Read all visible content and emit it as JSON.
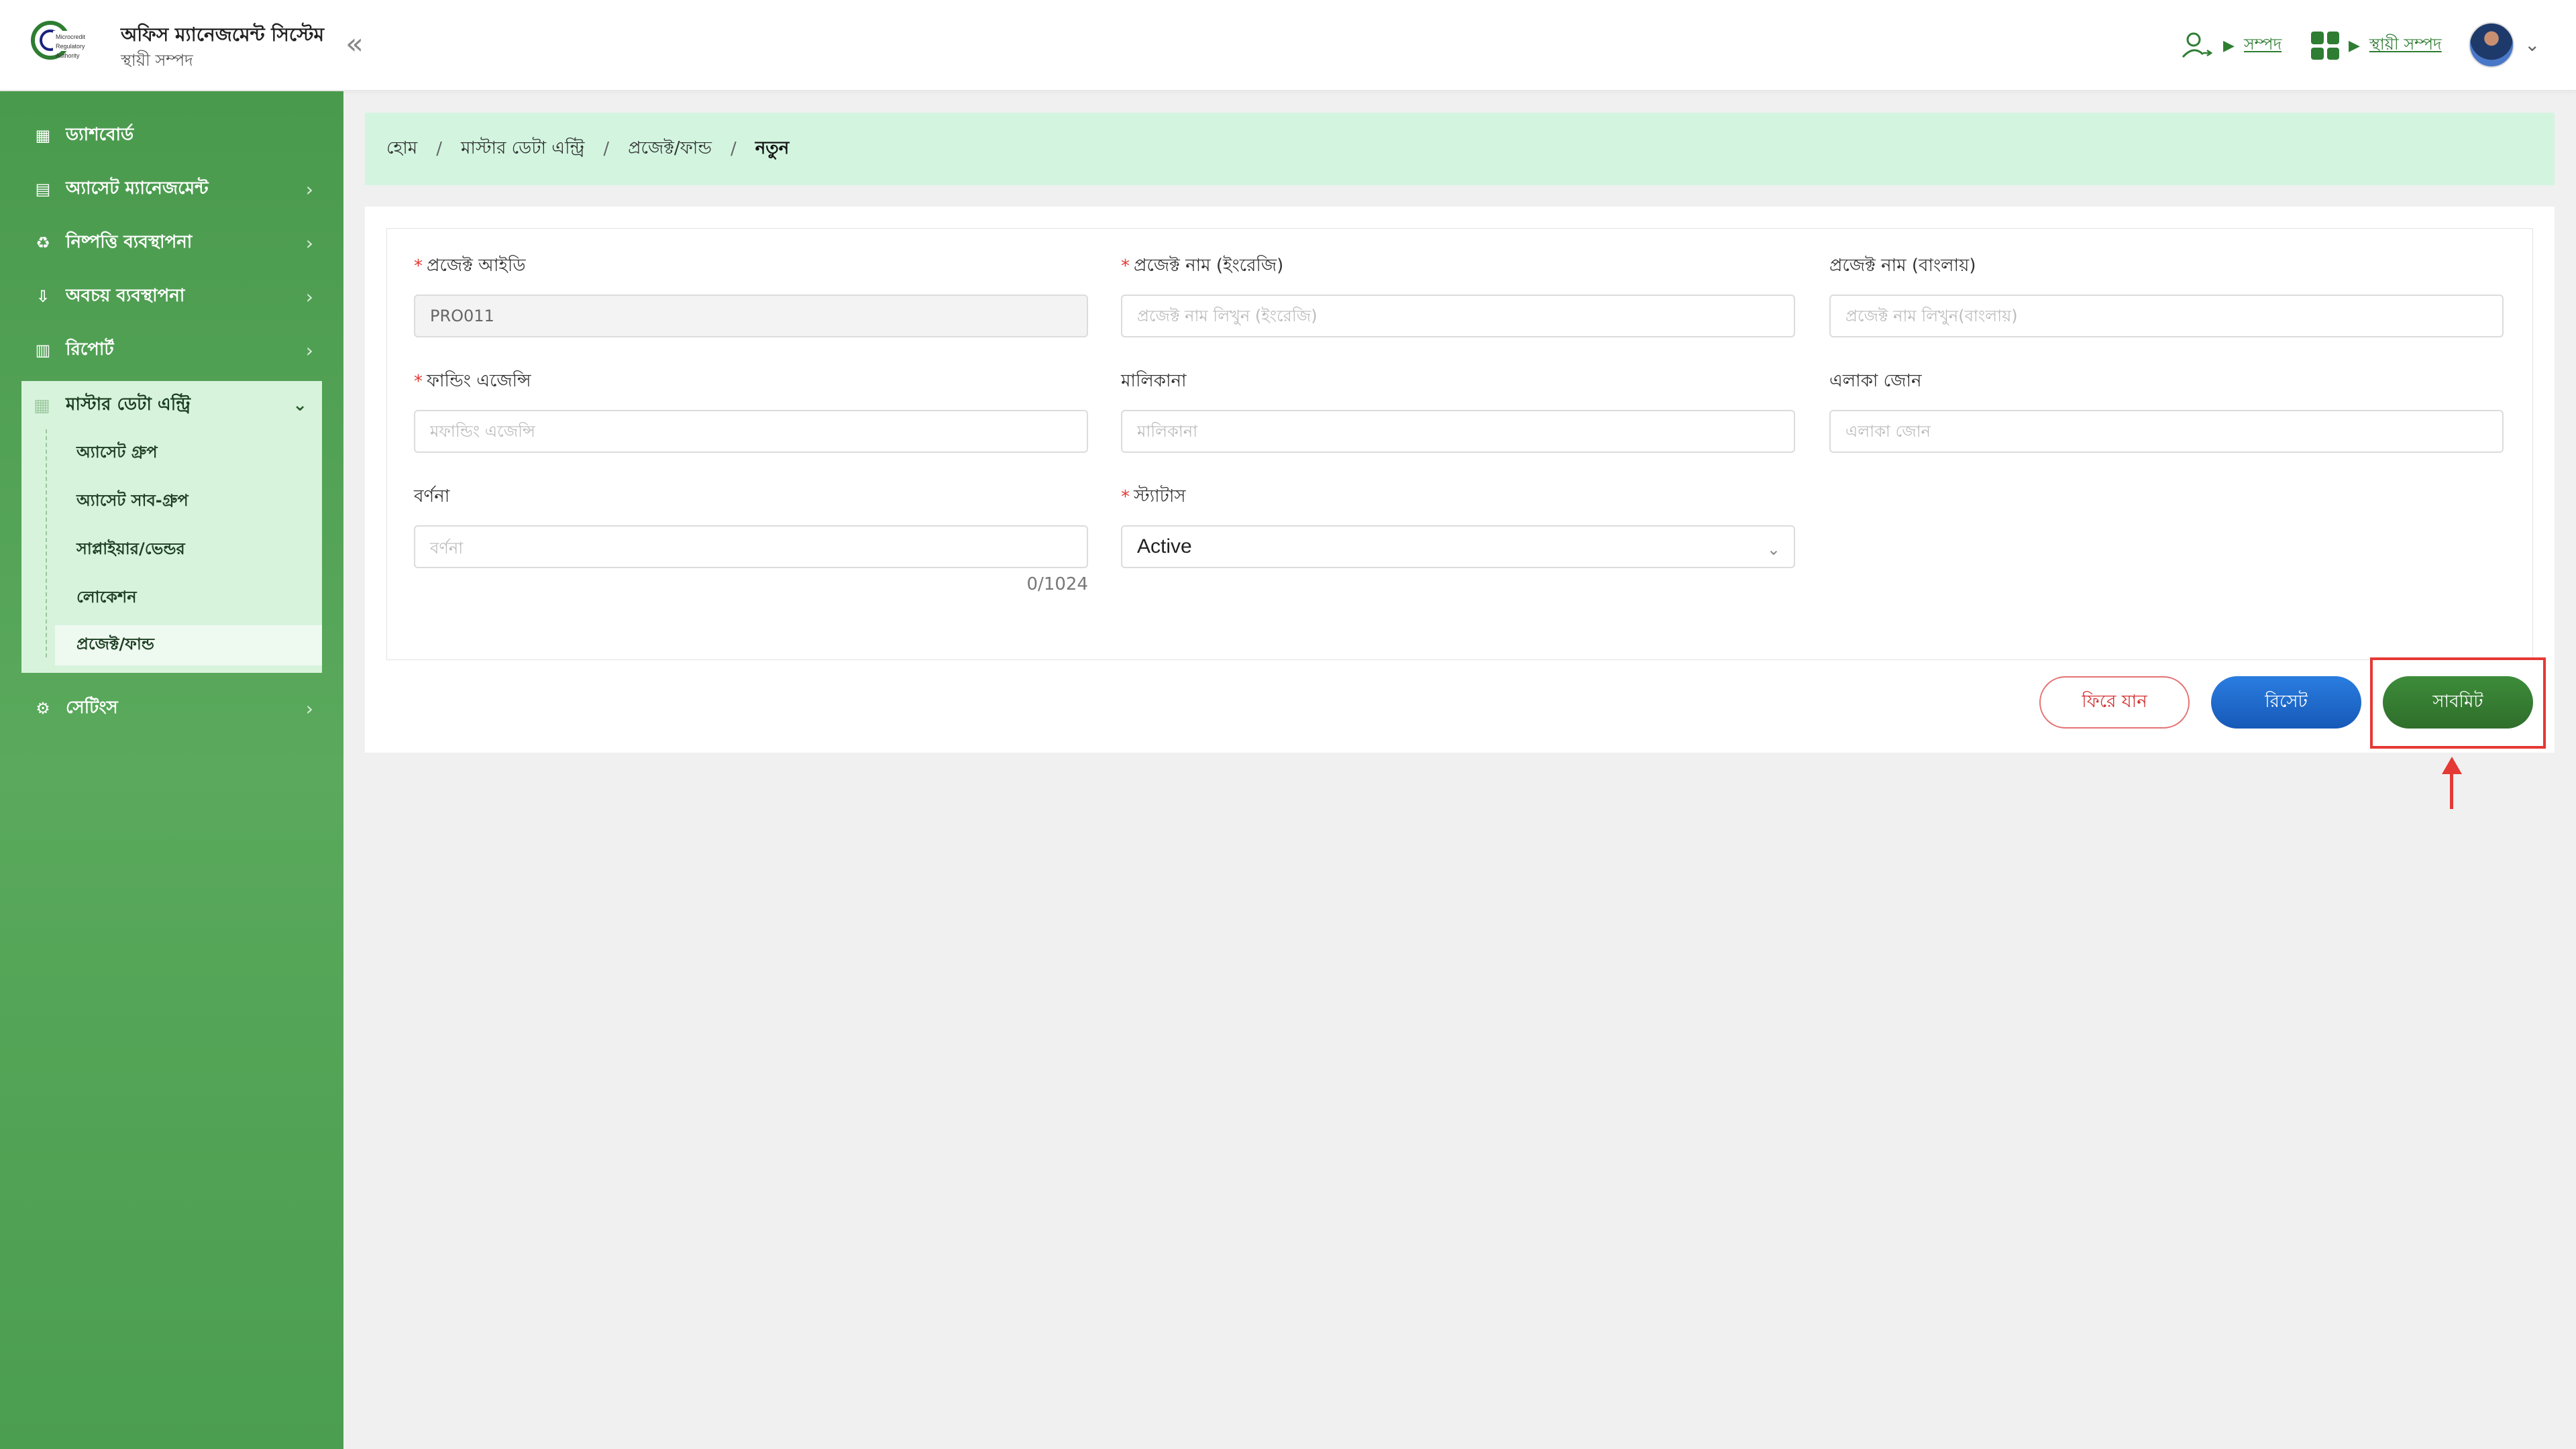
{
  "header": {
    "app_title": "অফিস ম্যানেজমেন্ট সিস্টেম",
    "app_subtitle": "স্থায়ী সম্পদ",
    "nav1_label": "সম্পদ",
    "nav2_label": "স্থায়ী সম্পদ"
  },
  "sidebar": {
    "items": [
      {
        "label": "ড্যাশবোর্ড",
        "icon": "dashboard-icon"
      },
      {
        "label": "অ্যাসেট ম্যানেজমেন্ট",
        "icon": "asset-icon"
      },
      {
        "label": "নিষ্পত্তি ব্যবস্থাপনা",
        "icon": "disposal-icon"
      },
      {
        "label": "অবচয় ব্যবস্থাপনা",
        "icon": "depreciation-icon"
      },
      {
        "label": "রিপোর্ট",
        "icon": "report-icon"
      },
      {
        "label": "মাস্টার ডেটা এন্ট্রি",
        "icon": "master-data-icon"
      },
      {
        "label": "সেটিংস",
        "icon": "gear-icon"
      }
    ],
    "submenu": [
      "অ্যাসেট গ্রুপ",
      "অ্যাসেট সাব-গ্রুপ",
      "সাপ্লাইয়ার/ভেন্ডর",
      "লোকেশন",
      "প্রজেক্ট/ফান্ড"
    ]
  },
  "breadcrumb": [
    "হোম",
    "মাস্টার ডেটা এন্ট্রি",
    "প্রজেক্ট/ফান্ড",
    "নতুন"
  ],
  "form": {
    "project_id": {
      "label": "প্রজেক্ট আইডি",
      "value": "PRO011"
    },
    "project_name_en": {
      "label": "প্রজেক্ট নাম (ইংরেজি)",
      "placeholder": "প্রজেক্ট নাম লিখুন (ইংরেজি)"
    },
    "project_name_bn": {
      "label": "প্রজেক্ট নাম (বাংলায়)",
      "placeholder": "প্রজেক্ট নাম লিখুন(বাংলায়)"
    },
    "funding_agency": {
      "label": "ফান্ডিং এজেন্সি",
      "placeholder": "মফান্ডিং এজেন্সি"
    },
    "ownership": {
      "label": "মালিকানা",
      "placeholder": "মালিকানা"
    },
    "area_zone": {
      "label": "এলাকা জোন",
      "placeholder": "এলাকা জোন"
    },
    "description": {
      "label": "বর্ণনা",
      "placeholder": "বর্ণনা",
      "counter": "0/1024"
    },
    "status": {
      "label": "স্ট্যাটাস",
      "value": "Active"
    }
  },
  "buttons": {
    "back": "ফিরে যান",
    "reset": "রিসেট",
    "submit": "সাবমিট"
  },
  "colors": {
    "primary_green": "#2e7d32",
    "breadcrumb_bg": "#d3f5e0",
    "highlight_red": "#e53935",
    "reset_blue": "#1659b8"
  }
}
